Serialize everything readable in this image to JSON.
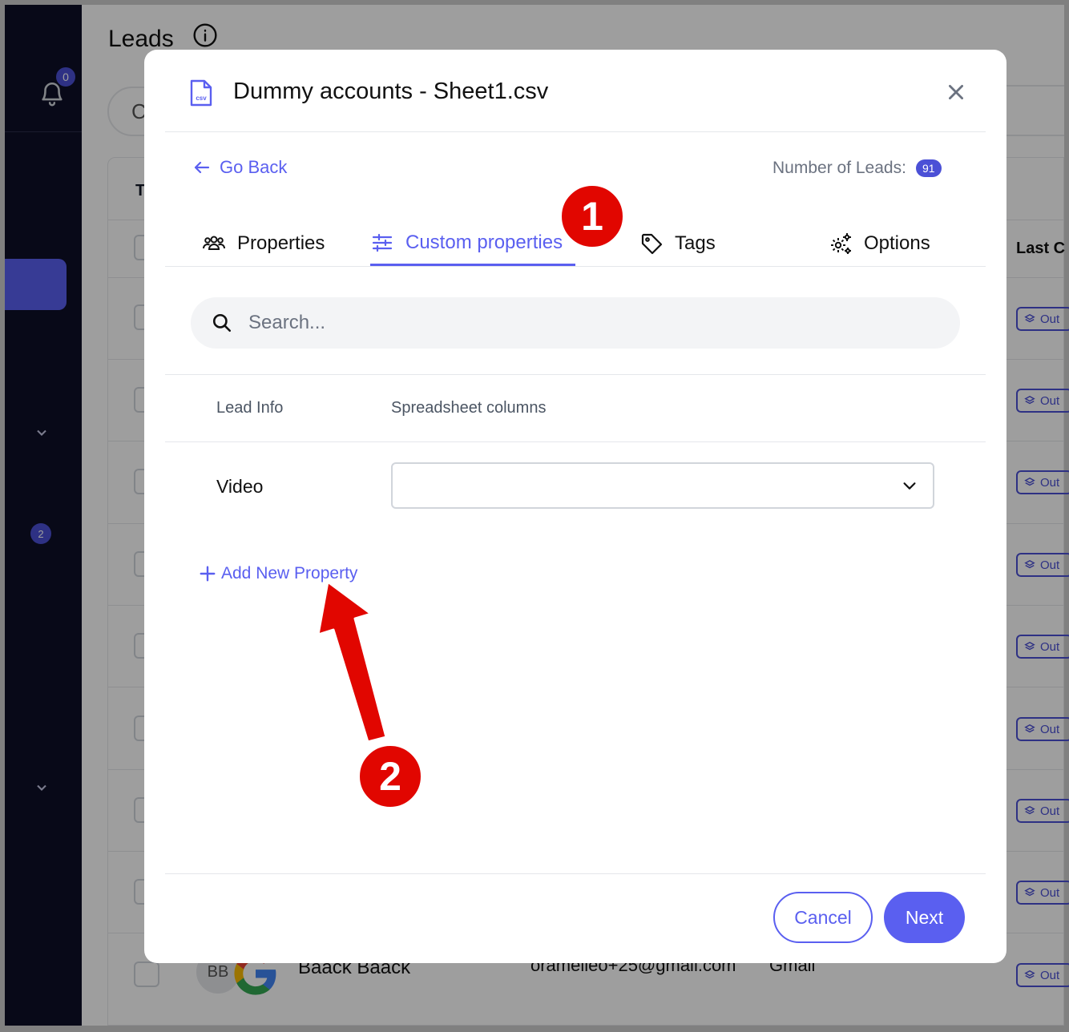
{
  "app": {
    "page_title": "Leads",
    "notification_count": "0",
    "sidebar_count": "2",
    "table": {
      "first_col_initial": "T",
      "last_col_label": "Last C",
      "action_label": "Out",
      "visible_row": {
        "avatar_initials": "BB",
        "name": "Baack Baack",
        "email": "oramelleo+25@gmail.com",
        "source": "Gmail"
      }
    }
  },
  "modal": {
    "title": "Dummy accounts - Sheet1.csv",
    "file_icon_label": "csv",
    "go_back_label": "Go Back",
    "leads_count_label": "Number of Leads:",
    "leads_count": "91",
    "tabs": [
      {
        "label": "Properties",
        "icon": "users-icon",
        "active": false
      },
      {
        "label": "Custom properties",
        "icon": "sliders-icon",
        "active": true
      },
      {
        "label": "Tags",
        "icon": "tag-icon",
        "active": false
      },
      {
        "label": "Options",
        "icon": "gears-icon",
        "active": false
      }
    ],
    "search": {
      "placeholder": "Search...",
      "value": ""
    },
    "columns": {
      "lead_info": "Lead Info",
      "spreadsheet_columns": "Spreadsheet columns"
    },
    "rows": [
      {
        "label": "Video",
        "selected_column": ""
      }
    ],
    "add_property_label": "Add New Property",
    "cancel_label": "Cancel",
    "next_label": "Next"
  },
  "annotations": {
    "marker_1": "1",
    "marker_2": "2",
    "color": "#e10600"
  },
  "colors": {
    "accent": "#5a5ff0",
    "sidebar": "#0e1028"
  }
}
